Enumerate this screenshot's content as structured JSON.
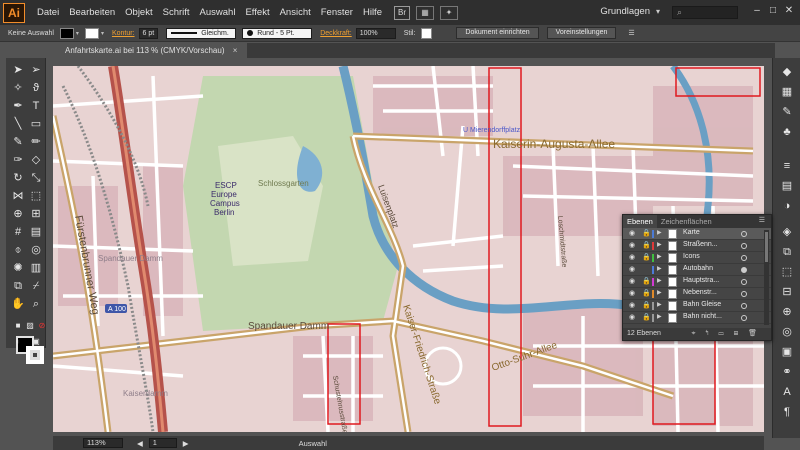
{
  "menubar": {
    "app_logo": "Ai",
    "items": [
      "Datei",
      "Bearbeiten",
      "Objekt",
      "Schrift",
      "Auswahl",
      "Effekt",
      "Ansicht",
      "Fenster",
      "Hilfe"
    ],
    "bridge_label": "Br",
    "workspace": "Grundlagen",
    "search_placeholder": ""
  },
  "control_bar": {
    "selection_label": "Keine Auswahl",
    "stroke_link": "Kontur:",
    "stroke_weight": "6 pt",
    "stroke_profile": "Gleichm.",
    "brush_label": "Rund - 5 Pt.",
    "opacity_link": "Deckkraft:",
    "opacity_value": "100%",
    "style_label": "Stil:",
    "doc_setup_button": "Dokument einrichten",
    "prefs_button": "Voreinstellungen"
  },
  "document": {
    "tab_title": "Anfahrtskarte.ai bei 113 % (CMYK/Vorschau)"
  },
  "status_bar": {
    "zoom": "113%",
    "page": "1",
    "status_text": "Auswahl"
  },
  "layers_panel": {
    "tab_active": "Ebenen",
    "tab_inactive": "Zeichenflächen",
    "footer": "12 Ebenen",
    "layers": [
      {
        "name": "Karte",
        "color": "#4c7bd6",
        "locked": true,
        "selected": true
      },
      {
        "name": "Straßenn...",
        "color": "#e03a3a",
        "locked": true,
        "selected": false
      },
      {
        "name": "Icons",
        "color": "#3fbf3f",
        "locked": true,
        "selected": false
      },
      {
        "name": "Autobahn",
        "color": "#4c7bd6",
        "locked": false,
        "selected": false
      },
      {
        "name": "Hauptstra...",
        "color": "#d23ad2",
        "locked": true,
        "selected": false
      },
      {
        "name": "Nebenstr...",
        "color": "#e08a2a",
        "locked": true,
        "selected": false
      },
      {
        "name": "Bahn Gleise",
        "color": "#9a9a9a",
        "locked": true,
        "selected": false
      },
      {
        "name": "Bahn nicht...",
        "color": "#9a9a9a",
        "locked": true,
        "selected": false
      }
    ]
  },
  "map": {
    "street_labels": [
      "Fürstenbrunner Weg",
      "Spandauer Damm",
      "Kaiserin-Augusta-Allee",
      "Luisenplatz",
      "Kaiser-Friedrich-Straße",
      "Otto-Suhr-Allee",
      "Loschmidtstraße",
      "Schlossgarten",
      "Spandauer Damm",
      "U Mierendorffplatz",
      "Schustehrusstraße",
      "Kaiserdamm"
    ],
    "poi_labels": [
      "ESCP",
      "Europe",
      "Campus",
      "Berlin"
    ],
    "motorway_badge": "A 100"
  }
}
